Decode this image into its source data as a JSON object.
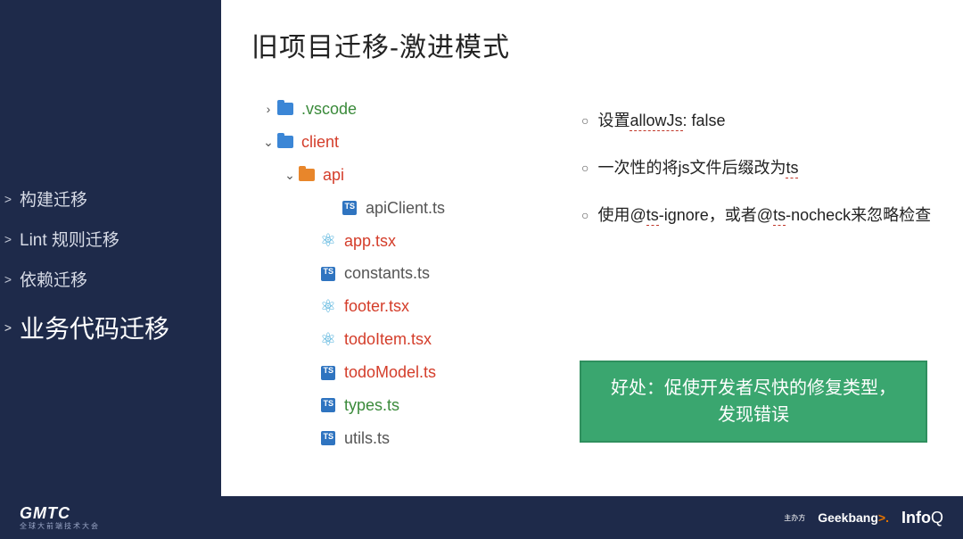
{
  "sidebar": [
    {
      "label": "构建迁移",
      "active": false
    },
    {
      "label": "Lint 规则迁移",
      "active": false
    },
    {
      "label": "依赖迁移",
      "active": false
    },
    {
      "label": "业务代码迁移",
      "active": true
    }
  ],
  "title": "旧项目迁移-激进模式",
  "tree": [
    {
      "indent": "ind1",
      "arrow": "›",
      "icon": "folder-blue",
      "label": ".vscode",
      "cls": "green"
    },
    {
      "indent": "ind1",
      "arrow": "⌄",
      "icon": "folder-blue",
      "label": "client",
      "cls": "red"
    },
    {
      "indent": "ind2",
      "arrow": "⌄",
      "icon": "folder-or",
      "label": "api",
      "cls": "red"
    },
    {
      "indent": "ind4",
      "arrow": "",
      "icon": "ts",
      "label": "apiClient.ts",
      "cls": "gray"
    },
    {
      "indent": "ind3",
      "arrow": "",
      "icon": "react",
      "label": "app.tsx",
      "cls": "red"
    },
    {
      "indent": "ind3",
      "arrow": "",
      "icon": "ts",
      "label": "constants.ts",
      "cls": "gray"
    },
    {
      "indent": "ind3",
      "arrow": "",
      "icon": "react",
      "label": "footer.tsx",
      "cls": "red"
    },
    {
      "indent": "ind3",
      "arrow": "",
      "icon": "react",
      "label": "todoItem.tsx",
      "cls": "red"
    },
    {
      "indent": "ind3",
      "arrow": "",
      "icon": "ts",
      "label": "todoModel.ts",
      "cls": "red"
    },
    {
      "indent": "ind3",
      "arrow": "",
      "icon": "ts",
      "label": "types.ts",
      "cls": "green"
    },
    {
      "indent": "ind3",
      "arrow": "",
      "icon": "ts",
      "label": "utils.ts",
      "cls": "gray"
    }
  ],
  "bullets": [
    {
      "pre": "设置",
      "u": "allowJs",
      "post": ": false"
    },
    {
      "pre": "一次性的将js文件后缀改为",
      "u": "ts",
      "post": ""
    },
    {
      "pre": "使用@",
      "u": "ts",
      "post": "-ignore，或者@",
      "u2": "ts",
      "post2": "-nocheck来忽略检查"
    }
  ],
  "benefit_box": "好处：促使开发者尽快的修复类型，发现错误",
  "footer": {
    "brand": "GMTC",
    "brand_sub": "全球大前端技术大会",
    "host": "主办方",
    "geek": "Geekbang",
    "infoq": "InfoQ"
  }
}
